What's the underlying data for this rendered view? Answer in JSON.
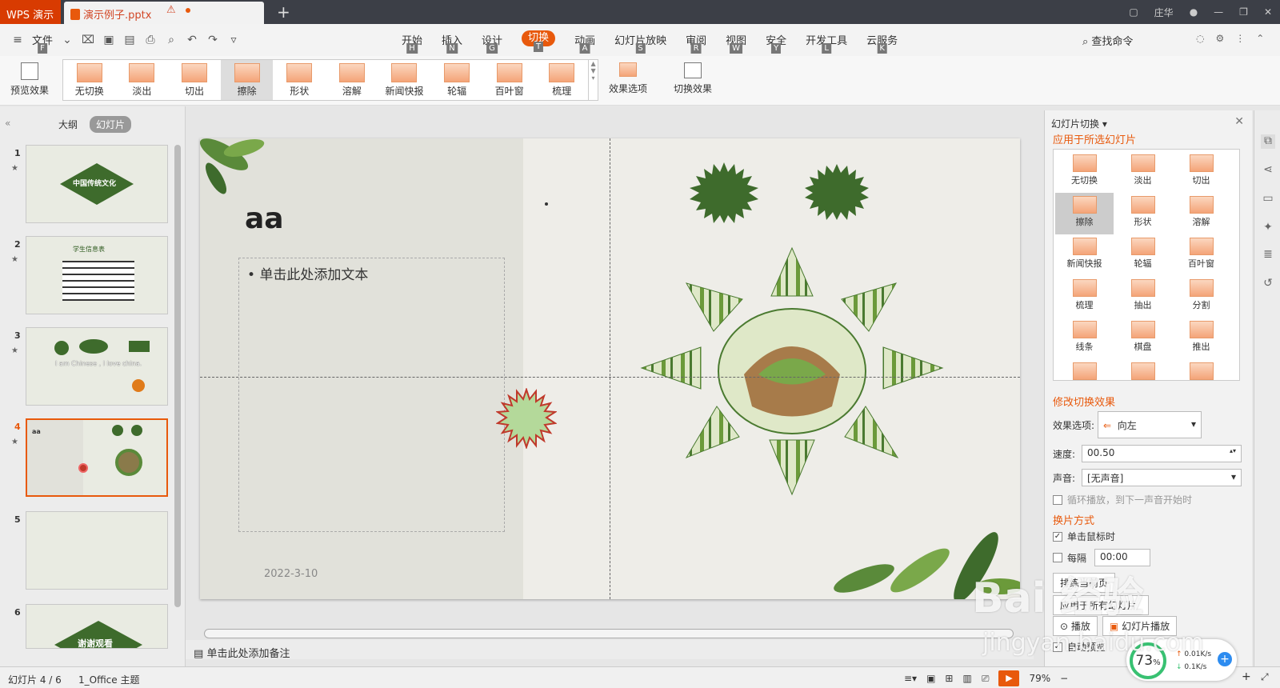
{
  "titlebar": {
    "app": "WPS 演示",
    "doc_tab": "演示例子.pptx",
    "warn": "⚠",
    "add": "+",
    "user": "庄华"
  },
  "menu": {
    "file": "文件",
    "file_key": "F",
    "tabs": [
      {
        "label": "开始",
        "key": "H"
      },
      {
        "label": "插入",
        "key": "N"
      },
      {
        "label": "设计",
        "key": "G"
      },
      {
        "label": "切换",
        "key": "T"
      },
      {
        "label": "动画",
        "key": "A"
      },
      {
        "label": "幻灯片放映",
        "key": "S"
      },
      {
        "label": "审阅",
        "key": "R"
      },
      {
        "label": "视图",
        "key": "W"
      },
      {
        "label": "安全",
        "key": "Y"
      },
      {
        "label": "开发工具",
        "key": "L"
      },
      {
        "label": "云服务",
        "key": "K"
      }
    ],
    "search": "查找命令"
  },
  "ribbon": {
    "preview": "预览效果",
    "gallery": [
      "无切换",
      "淡出",
      "切出",
      "擦除",
      "形状",
      "溶解",
      "新闻快报",
      "轮辐",
      "百叶窗",
      "梳理"
    ],
    "effect_options": "效果选项",
    "switch_effect": "切换效果"
  },
  "left_panel": {
    "outline": "大纲",
    "slides": "幻灯片",
    "thumbs": [
      {
        "num": "1",
        "text": "中国传统文化"
      },
      {
        "num": "2",
        "text": "学生信息表"
      },
      {
        "num": "3",
        "text": "I am Chinese , I love china."
      },
      {
        "num": "4",
        "text": "aa"
      },
      {
        "num": "5",
        "text": ""
      },
      {
        "num": "6",
        "text": "谢谢观看"
      }
    ]
  },
  "slide": {
    "title": "aa",
    "body": "单击此处添加文本",
    "date": "2022-3-10"
  },
  "notes": "单击此处添加备注",
  "right_panel": {
    "title": "幻灯片切换",
    "apply_header": "应用于所选幻灯片",
    "effects": [
      "无切换",
      "淡出",
      "切出",
      "擦除",
      "形状",
      "溶解",
      "新闻快报",
      "轮辐",
      "百叶窗",
      "梳理",
      "抽出",
      "分割",
      "线条",
      "棋盘",
      "推出"
    ],
    "modify_header": "修改切换效果",
    "effect_option_label": "效果选项:",
    "effect_option_value": "向左",
    "speed_label": "速度:",
    "speed_value": "00.50",
    "sound_label": "声音:",
    "sound_value": "[无声音]",
    "loop_label": "循环播放，到下一声音开始时",
    "switch_mode_header": "换片方式",
    "on_click": "单击鼠标时",
    "every": "每隔",
    "every_value": "00:00",
    "apply_current": "排练当前页",
    "apply_all": "应用于所有幻灯片",
    "play": "播放",
    "slideshow": "幻灯片播放",
    "auto_preview": "自动预览"
  },
  "status": {
    "slide_info": "幻灯片 4 / 6",
    "theme": "1_Office 主题",
    "zoom": "79%",
    "minus": "−",
    "plus": "+"
  },
  "network": {
    "percent": "73",
    "unit": "%",
    "up": "0.01K/s",
    "down": "0.1K/s"
  },
  "watermark": {
    "brand": "Bai 经验",
    "url": "jingyan.baidu.com"
  },
  "colors": {
    "accent": "#e8590c",
    "leaf_green": "#4a7a30"
  }
}
